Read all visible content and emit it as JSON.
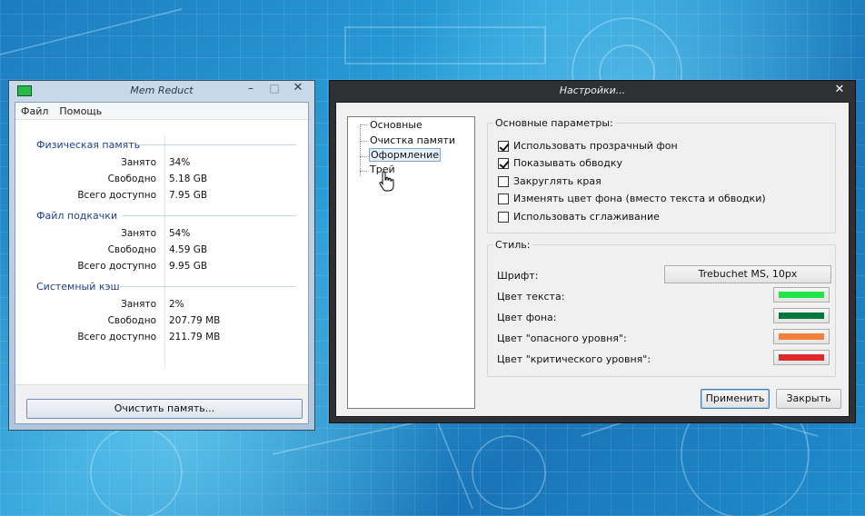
{
  "colors": {
    "text_color": "#22e54a",
    "background_color": "#007a3c",
    "danger_color": "#f27f3a",
    "critical_color": "#e0282b"
  },
  "mem_reduct": {
    "title": "Mem Reduct",
    "menu": [
      "Файл",
      "Помощь"
    ],
    "sections": [
      {
        "title": "Физическая память",
        "rows": [
          {
            "label": "Занято",
            "value": "34%"
          },
          {
            "label": "Свободно",
            "value": "5.18 GB"
          },
          {
            "label": "Всего доступно",
            "value": "7.95 GB"
          }
        ]
      },
      {
        "title": "Файл подкачки",
        "rows": [
          {
            "label": "Занято",
            "value": "54%"
          },
          {
            "label": "Свободно",
            "value": "4.59 GB"
          },
          {
            "label": "Всего доступно",
            "value": "9.95 GB"
          }
        ]
      },
      {
        "title": "Системный кэш",
        "rows": [
          {
            "label": "Занято",
            "value": "2%"
          },
          {
            "label": "Свободно",
            "value": "207.79 MB"
          },
          {
            "label": "Всего доступно",
            "value": "211.79 MB"
          }
        ]
      }
    ],
    "clear_button": "Очистить память..."
  },
  "settings": {
    "title": "Настройки...",
    "tree": [
      "Основные",
      "Очистка памяти",
      "Оформление",
      "Трей"
    ],
    "selected_tree_item": "Оформление",
    "basic_group_title": "Основные параметры:",
    "checkboxes": [
      {
        "label": "Использовать прозрачный фон",
        "checked": true
      },
      {
        "label": "Показывать обводку",
        "checked": true
      },
      {
        "label": "Закруглять края",
        "checked": false
      },
      {
        "label": "Изменять цвет фона (вместо текста и обводки)",
        "checked": false
      },
      {
        "label": "Использовать сглаживание",
        "checked": false
      }
    ],
    "style_group_title": "Стиль:",
    "font_label": "Шрифт:",
    "font_value": "Trebuchet MS, 10px",
    "color_rows": [
      "Цвет текста:",
      "Цвет фона:",
      "Цвет \"опасного уровня\":",
      "Цвет \"критического уровня\":"
    ],
    "apply_button": "Применить",
    "close_button": "Закрыть"
  }
}
